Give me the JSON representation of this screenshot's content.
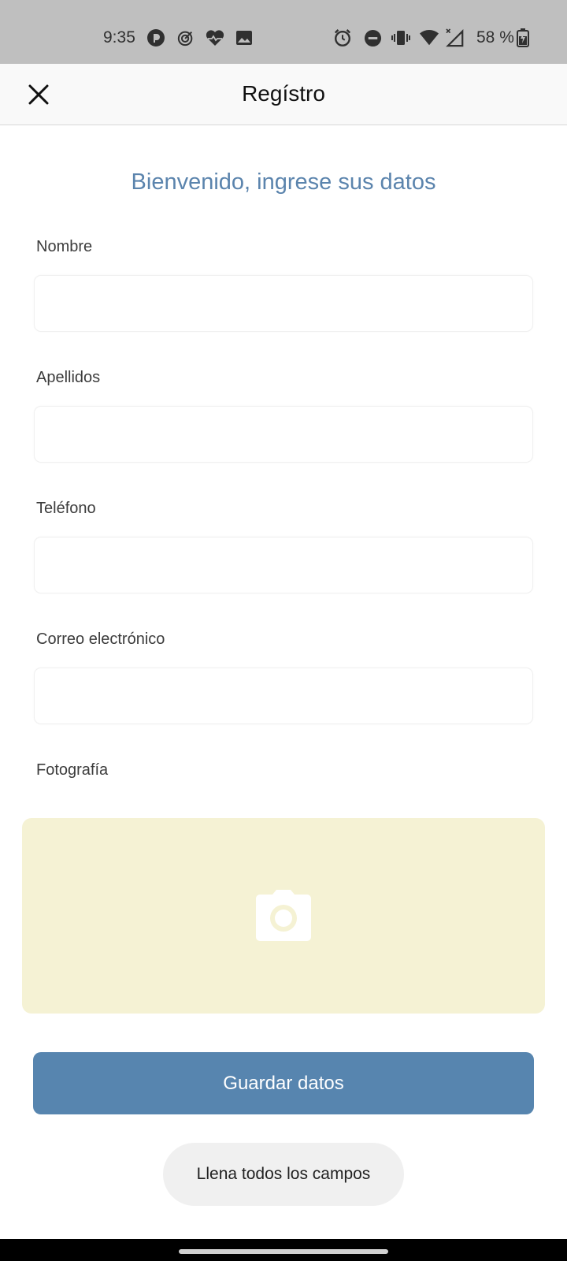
{
  "status_bar": {
    "time": "9:35",
    "battery": "58 %",
    "left_icons": [
      "pocketcasts-icon",
      "target-icon",
      "heart-rate-icon",
      "image-icon"
    ],
    "right_icons": [
      "alarm-icon",
      "do-not-disturb-icon",
      "vibrate-icon",
      "wifi-icon",
      "signal-icon",
      "battery-charging-icon"
    ]
  },
  "app_bar": {
    "title": "Regístro",
    "close_icon": "close-icon"
  },
  "form": {
    "welcome": "Bienvenido, ingrese sus datos",
    "fields": [
      {
        "label": "Nombre",
        "value": "",
        "placeholder": ""
      },
      {
        "label": "Apellidos",
        "value": "",
        "placeholder": ""
      },
      {
        "label": "Teléfono",
        "value": "",
        "placeholder": ""
      },
      {
        "label": "Correo electrónico",
        "value": "",
        "placeholder": ""
      }
    ],
    "photo_label": "Fotografía",
    "photo_icon": "camera-icon",
    "save_label": "Guardar datos"
  },
  "toast": {
    "message": "Llena todos los campos"
  },
  "colors": {
    "accent": "#5785af",
    "welcome_text": "#5b84ad",
    "photo_bg": "#f5f2d4",
    "status_bar_bg": "#bfbfbf"
  }
}
